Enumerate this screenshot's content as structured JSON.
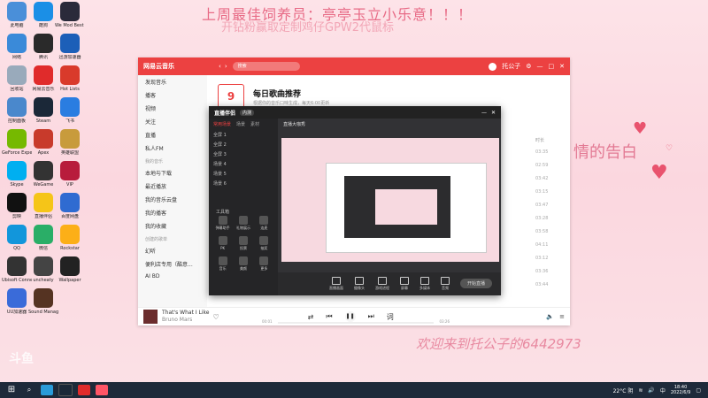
{
  "overlay": {
    "line1": "上周最佳饲养员：亭亭玉立小乐意！！！",
    "line2": "开钻粉赢取定制鸡仔GPW2代鼠标",
    "bottom_text": "欢迎来到托公子的6442973",
    "right_text": "情的告白",
    "watermark": "斗鱼"
  },
  "desktop_icons": [
    {
      "label": "此电脑",
      "color": "#4a8fd9"
    },
    {
      "label": "酷狗",
      "color": "#1b8fe6"
    },
    {
      "label": "We Mod Best T...",
      "color": "#2a2a3a"
    },
    {
      "label": "网络",
      "color": "#3a8ad9"
    },
    {
      "label": "腾讯",
      "color": "#2a2a2a"
    },
    {
      "label": "迅游加速器",
      "color": "#1c5fb8"
    },
    {
      "label": "回收站",
      "color": "#9ab"
    },
    {
      "label": "网易云音乐",
      "color": "#e02b2b"
    },
    {
      "label": "Hot Lists",
      "color": "#d93a2b"
    },
    {
      "label": "控制面板",
      "color": "#4a88cc"
    },
    {
      "label": "Steam",
      "color": "#1b2838"
    },
    {
      "label": "飞书",
      "color": "#2a7de1"
    },
    {
      "label": "GeForce Experience",
      "color": "#76b900"
    },
    {
      "label": "Apex",
      "color": "#c83a2b"
    },
    {
      "label": "英雄联盟",
      "color": "#c89b3c"
    },
    {
      "label": "Skype",
      "color": "#00aff0"
    },
    {
      "label": "WeGame",
      "color": "#333"
    },
    {
      "label": "VIP",
      "color": "#b81c3c"
    },
    {
      "label": "剪映",
      "color": "#111"
    },
    {
      "label": "直播伴侣",
      "color": "#f5c518"
    },
    {
      "label": "百度网盘",
      "color": "#2f6bd1"
    },
    {
      "label": "QQ",
      "color": "#1296db"
    },
    {
      "label": "微信",
      "color": "#2aae67"
    },
    {
      "label": "Rockstar",
      "color": "#fcaf17"
    },
    {
      "label": "Ubisoft Connect",
      "color": "#333"
    },
    {
      "label": "uncheaty",
      "color": "#444"
    },
    {
      "label": "Wallpaper",
      "color": "#222"
    },
    {
      "label": "UU加速器",
      "color": "#3a6bd9"
    },
    {
      "label": "Sound Manager",
      "color": "#553322"
    }
  ],
  "music_app": {
    "logo": "网易云音乐",
    "search_placeholder": "搜索",
    "user": "托公子",
    "sidebar": {
      "items": [
        "发现音乐",
        "播客",
        "视频",
        "关注",
        "直播",
        "私人FM"
      ],
      "my_music_head": "我的音乐",
      "my_items": [
        "本地与下载",
        "最近播放",
        "我的音乐云盘",
        "我的播客",
        "我的收藏"
      ],
      "created_head": "创建的歌单",
      "playlists": [
        "幻听",
        "便利店专用（酷意...",
        "AI BD"
      ]
    },
    "daily": {
      "day": "9",
      "title": "每日歌曲推荐",
      "subtitle": "根据你的音乐口味生成，每天6:00更新"
    },
    "col_time": "时长",
    "durations": [
      "03:35",
      "02:59",
      "03:42",
      "03:15",
      "03:47",
      "03:28",
      "03:58",
      "04:11",
      "03:12",
      "03:36",
      "03:44"
    ],
    "player": {
      "song": "That's What I Like",
      "artist": "Bruno Mars",
      "time_current": "00:01",
      "time_total": "03:26"
    }
  },
  "stream_app": {
    "brand": "直播伴侣",
    "version": "内测",
    "tabs": [
      "常用场景",
      "场景",
      "素材"
    ],
    "scenes": [
      "全屏 1",
      "全屏 2",
      "全屏 3",
      "场景 4",
      "场景 5",
      "场景 6"
    ],
    "tools_head": "工具箱",
    "tools": [
      "弹幕助手",
      "礼物展示",
      "连麦",
      "PK",
      "投票",
      "抽奖",
      "音乐",
      "美颜",
      "更多"
    ],
    "live_title": "直播大咖秀",
    "bottom_tools": [
      "直播画面",
      "摄像头",
      "游戏进程",
      "屏幕",
      "多媒体",
      "音频"
    ],
    "start_label": "开始直播"
  },
  "taskbar": {
    "weather": "22°C 阴",
    "time": "18:40",
    "date": "2022/6/9",
    "lang": "中"
  }
}
